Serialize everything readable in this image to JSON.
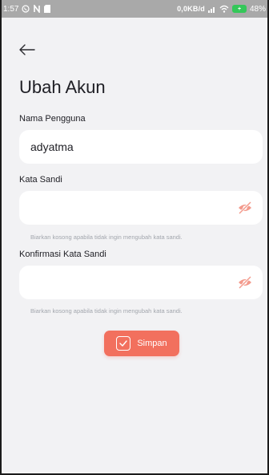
{
  "status_bar": {
    "time": "1:57",
    "network_speed": "0,0KB/d",
    "battery_percent": "48%",
    "icons": [
      "whatsapp-icon",
      "n-icon",
      "sd-card-icon",
      "signal-icon",
      "wifi-icon",
      "battery-icon"
    ]
  },
  "header": {
    "back_icon": "arrow-left-icon",
    "title": "Ubah Akun"
  },
  "form": {
    "username": {
      "label": "Nama Pengguna",
      "value": "adyatma"
    },
    "password": {
      "label": "Kata Sandi",
      "value": "",
      "toggle_icon": "eye-off-icon",
      "hint": "Biarkan kosong apabila tidak ingin mengubah kata sandi."
    },
    "confirm_password": {
      "label": "Konfirmasi Kata Sandi",
      "value": "",
      "toggle_icon": "eye-off-icon",
      "hint": "Biarkan kosong apabila tidak ingin mengubah kata sandi."
    },
    "save_button": {
      "label": "Simpan",
      "icon": "check-square-icon"
    }
  },
  "colors": {
    "accent": "#f2705e",
    "background": "#f2f2f4",
    "field": "#ffffff",
    "eye_icon": "#f39a8c",
    "hint_text": "#a2a6ad"
  }
}
